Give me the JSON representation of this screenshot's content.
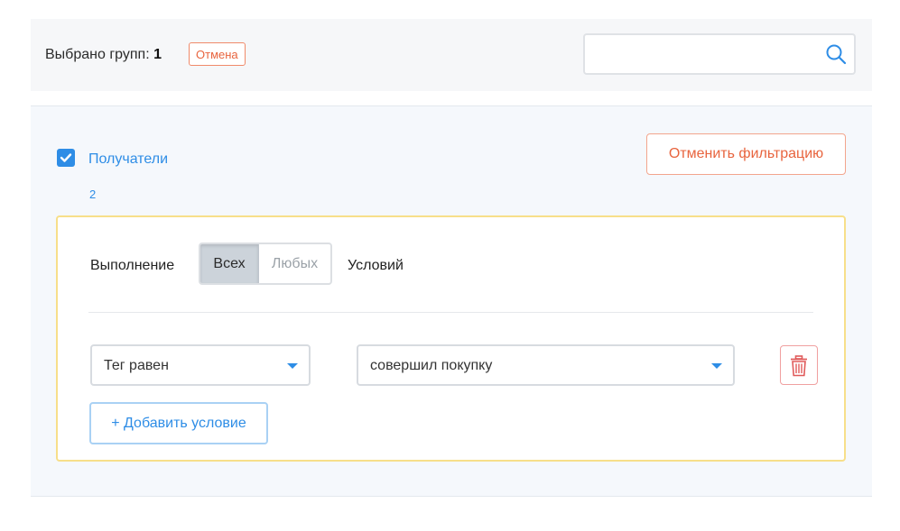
{
  "topbar": {
    "selected_label": "Выбрано групп:",
    "selected_count": "1",
    "cancel_label": "Отмена",
    "search": {
      "value": "",
      "placeholder": ""
    }
  },
  "group": {
    "checked": true,
    "name": "Получатели",
    "count": "2",
    "unfilter_label": "Отменить фильтрацию"
  },
  "filter": {
    "execution_label": "Выполнение",
    "mode_options": [
      "Всех",
      "Любых"
    ],
    "mode_selected": "Всех",
    "conditions_label": "Условий",
    "conditions": [
      {
        "field": "Тег равен",
        "value": "совершил покупку"
      }
    ],
    "add_label": "+ Добавить условие"
  },
  "colors": {
    "accent": "#2e8de6",
    "danger": "#e8643e",
    "filter_border": "#f7df8a",
    "panel_bg": "#f5f8fc"
  },
  "icons": [
    "search-icon",
    "check-icon",
    "caret-down-icon",
    "trash-icon"
  ]
}
